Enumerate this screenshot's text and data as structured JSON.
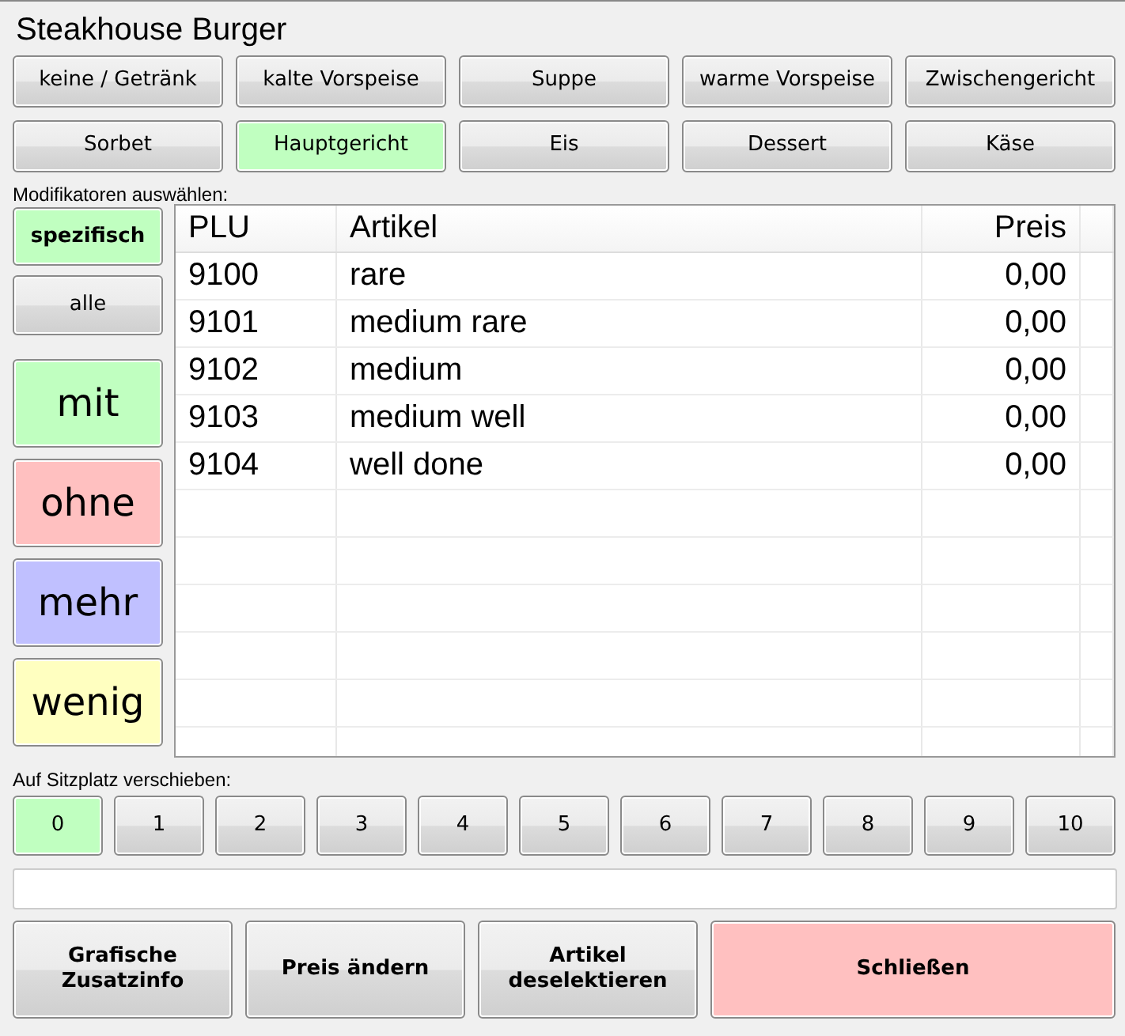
{
  "title": "Steakhouse Burger",
  "courses": [
    {
      "label": "keine / Getränk",
      "selected": false
    },
    {
      "label": "kalte Vorspeise",
      "selected": false
    },
    {
      "label": "Suppe",
      "selected": false
    },
    {
      "label": "warme Vorspeise",
      "selected": false
    },
    {
      "label": "Zwischengericht",
      "selected": false
    },
    {
      "label": "Sorbet",
      "selected": false
    },
    {
      "label": "Hauptgericht",
      "selected": true
    },
    {
      "label": "Eis",
      "selected": false
    },
    {
      "label": "Dessert",
      "selected": false
    },
    {
      "label": "Käse",
      "selected": false
    }
  ],
  "modifier_label": "Modifikatoren auswählen:",
  "scope": [
    {
      "label": "spezifisch",
      "selected": true
    },
    {
      "label": "alle",
      "selected": false
    }
  ],
  "modifiers": [
    {
      "label": "mit",
      "color": "#c0ffc0"
    },
    {
      "label": "ohne",
      "color": "#ffc0c0"
    },
    {
      "label": "mehr",
      "color": "#c0c0ff"
    },
    {
      "label": "wenig",
      "color": "#ffffc0"
    }
  ],
  "table": {
    "columns": [
      "PLU",
      "Artikel",
      "Preis"
    ],
    "rows": [
      [
        "9100",
        "rare",
        "0,00"
      ],
      [
        "9101",
        "medium rare",
        "0,00"
      ],
      [
        "9102",
        "medium",
        "0,00"
      ],
      [
        "9103",
        "medium well",
        "0,00"
      ],
      [
        "9104",
        "well done",
        "0,00"
      ]
    ]
  },
  "seat_label": "Auf Sitzplatz verschieben:",
  "seats": [
    {
      "label": "0",
      "selected": true
    },
    {
      "label": "1",
      "selected": false
    },
    {
      "label": "2",
      "selected": false
    },
    {
      "label": "3",
      "selected": false
    },
    {
      "label": "4",
      "selected": false
    },
    {
      "label": "5",
      "selected": false
    },
    {
      "label": "6",
      "selected": false
    },
    {
      "label": "7",
      "selected": false
    },
    {
      "label": "8",
      "selected": false
    },
    {
      "label": "9",
      "selected": false
    },
    {
      "label": "10",
      "selected": false
    }
  ],
  "actions": [
    {
      "label": "Grafische\nZusatzinfo",
      "kind": "normal"
    },
    {
      "label": "Preis ändern",
      "kind": "normal"
    },
    {
      "label": "Artikel\ndeselektieren",
      "kind": "normal"
    },
    {
      "label": "Schließen",
      "kind": "danger"
    }
  ]
}
